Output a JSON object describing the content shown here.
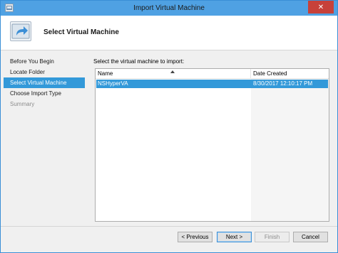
{
  "window": {
    "title": "Import Virtual Machine",
    "close_label": "✕"
  },
  "header": {
    "title": "Select Virtual Machine"
  },
  "sidebar": {
    "items": [
      {
        "label": "Before You Begin",
        "state": "normal"
      },
      {
        "label": "Locate Folder",
        "state": "normal"
      },
      {
        "label": "Select Virtual Machine",
        "state": "active"
      },
      {
        "label": "Choose Import Type",
        "state": "normal"
      },
      {
        "label": "Summary",
        "state": "disabled"
      }
    ]
  },
  "main": {
    "prompt": "Select the virtual machine to import:",
    "list": {
      "columns": [
        "Name",
        "Date Created"
      ],
      "rows": [
        {
          "name": "NSHyperVA",
          "date_created": "8/30/2017 12:10:17 PM",
          "selected": true
        }
      ]
    }
  },
  "footer": {
    "previous_label": "< Previous",
    "next_label": "Next >",
    "finish_label": "Finish",
    "cancel_label": "Cancel"
  },
  "colors": {
    "accent": "#3399d9",
    "titlebar": "#4fa1e3",
    "close": "#c7413a"
  },
  "icons": {
    "app": "hyperv-app-icon",
    "header": "import-arrow-icon"
  }
}
